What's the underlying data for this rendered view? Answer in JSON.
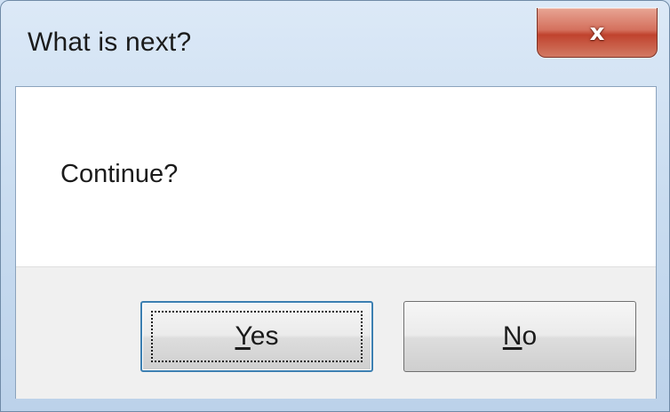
{
  "window": {
    "title": "What is next?",
    "close_glyph": "x",
    "close_icon": "close-icon"
  },
  "dialog": {
    "message": "Continue?",
    "buttons": {
      "yes": {
        "accel": "Y",
        "rest": "es",
        "is_default": true,
        "focused": true
      },
      "no": {
        "accel": "N",
        "rest": "o",
        "is_default": false,
        "focused": false
      }
    }
  },
  "colors": {
    "frame": "#c9dcf0",
    "close_button": "#c7503b",
    "default_button_border": "#3c7fb1",
    "client_background": "#f0f0f0",
    "message_background": "#ffffff"
  }
}
